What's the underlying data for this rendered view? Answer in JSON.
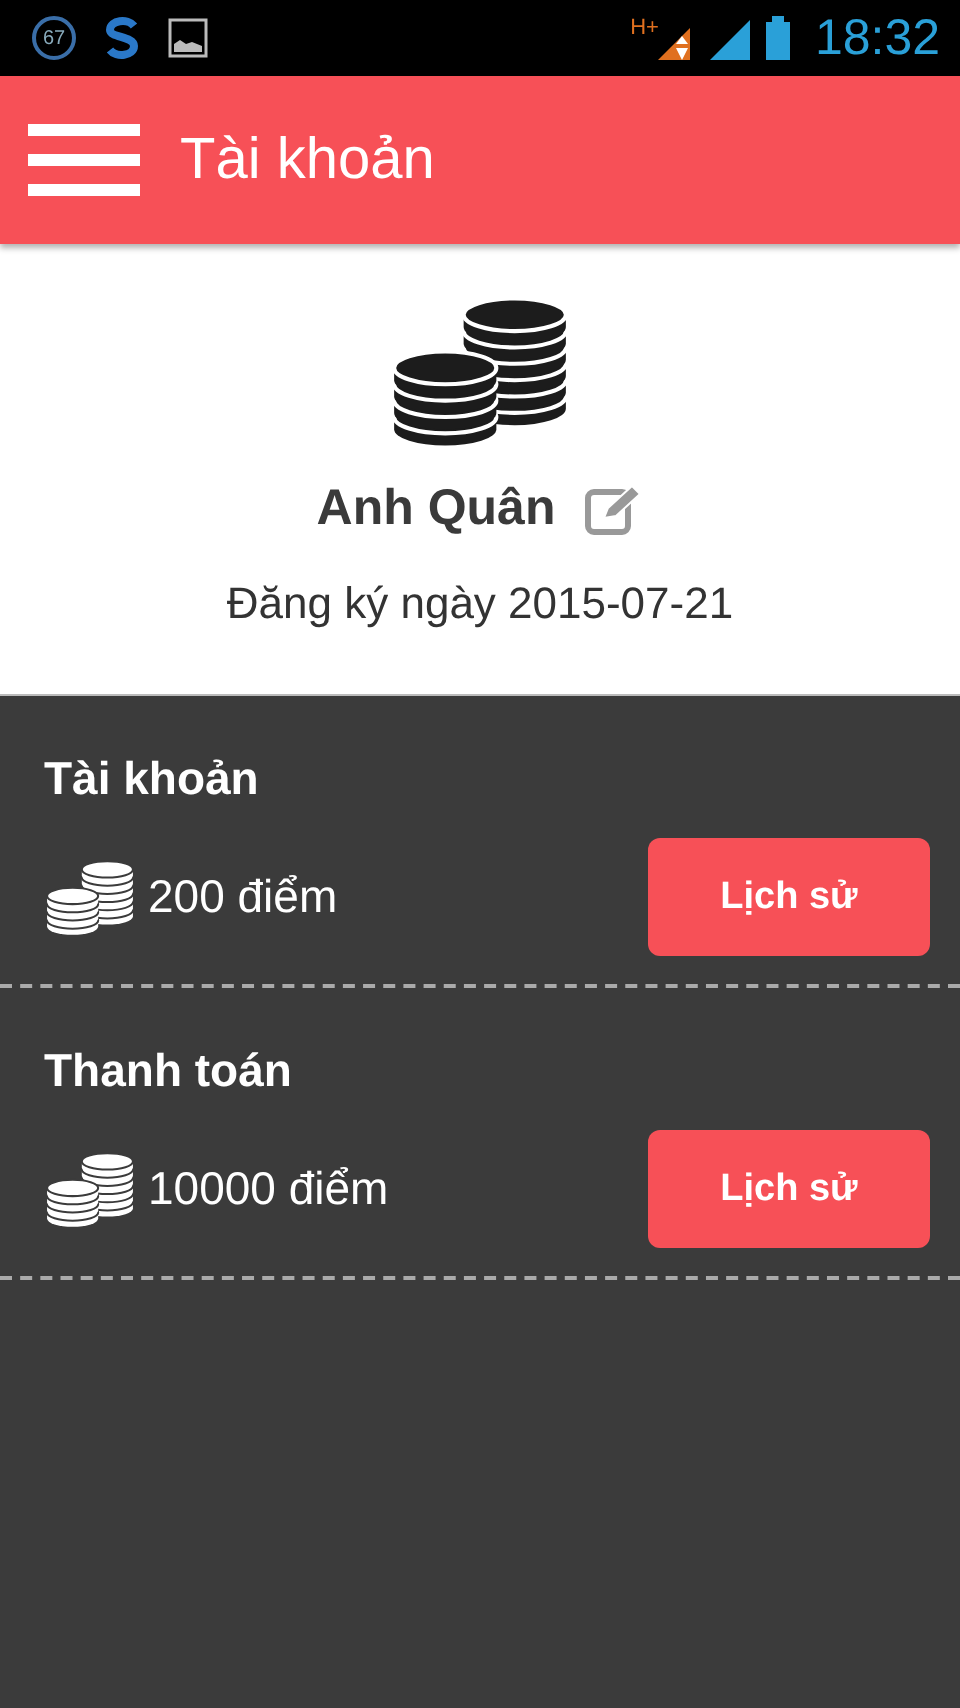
{
  "status_bar": {
    "notification_count": "67",
    "network": "H+",
    "time": "18:32"
  },
  "app_bar": {
    "title": "Tài khoản"
  },
  "profile": {
    "name": "Anh Quân",
    "registered": "Đăng ký ngày 2015-07-21"
  },
  "accounts": [
    {
      "title": "Tài khoản",
      "points": "200 điểm",
      "button": "Lịch sử"
    },
    {
      "title": "Thanh toán",
      "points": "10000 điểm",
      "button": "Lịch sử"
    }
  ]
}
